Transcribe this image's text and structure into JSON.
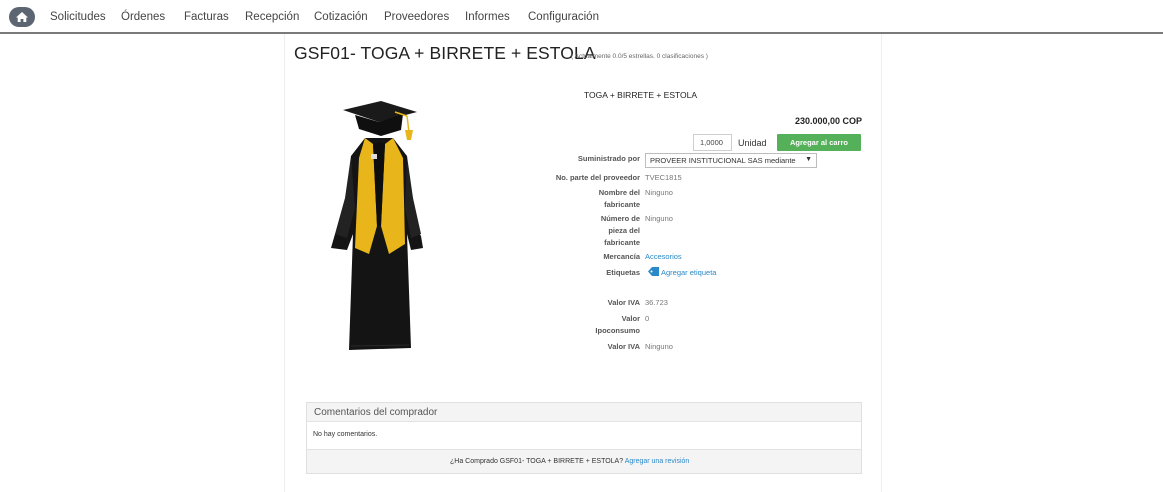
{
  "nav": {
    "items": [
      {
        "label": "Solicitudes"
      },
      {
        "label": "Órdenes"
      },
      {
        "label": "Facturas"
      },
      {
        "label": "Recepción"
      },
      {
        "label": "Cotización"
      },
      {
        "label": "Proveedores"
      },
      {
        "label": "Informes"
      },
      {
        "label": "Configuración"
      }
    ],
    "home_icon": "home-icon"
  },
  "product": {
    "title": "GSF01- TOGA + BIRRETE + ESTOLA",
    "rating_text": "( Actualmente 0.0/5 estrellas. 0 clasificaciones )",
    "subtitle": "TOGA + BIRRETE + ESTOLA",
    "price": "230.000,00 COP",
    "quantity": "1,0000",
    "unit": "Unidad",
    "add_to_cart": "Agregar al carro",
    "image_icon": "graduation-gown-image"
  },
  "details": {
    "supplier_label": "Suministrado por",
    "supplier_value": "PROVEER INSTITUCIONAL SAS mediante",
    "part_label": "No. parte del proveedor",
    "part_value": "TVEC1815",
    "maker_label_1": "Nombre del",
    "maker_label_2": "fabricante",
    "maker_value": "Ninguno",
    "maker_part_label_1": "Número de",
    "maker_part_label_2": "pieza del",
    "maker_part_label_3": "fabricante",
    "maker_part_value": "Ninguno",
    "merch_label": "Mercancía",
    "merch_value": "Accesorios",
    "tags_label": "Etiquetas",
    "tags_value": "Agregar etiqueta",
    "iva_label": "Valor IVA",
    "iva_value": "36.723",
    "ipo_label_1": "Valor",
    "ipo_label_2": "Ipoconsumo",
    "ipo_value": "0",
    "iva2_label": "Valor IVA",
    "iva2_value": "Ninguno"
  },
  "comments": {
    "title": "Comentarios del comprador",
    "empty": "No hay comentarios.",
    "question": "¿Ha Comprado GSF01- TOGA + BIRRETE + ESTOLA?",
    "review_link": "Agregar una revisión"
  },
  "colors": {
    "cart_button": "#55b05a",
    "link": "#2a89c8",
    "gown_black": "#141414",
    "stole_gold": "#e8b61b"
  }
}
